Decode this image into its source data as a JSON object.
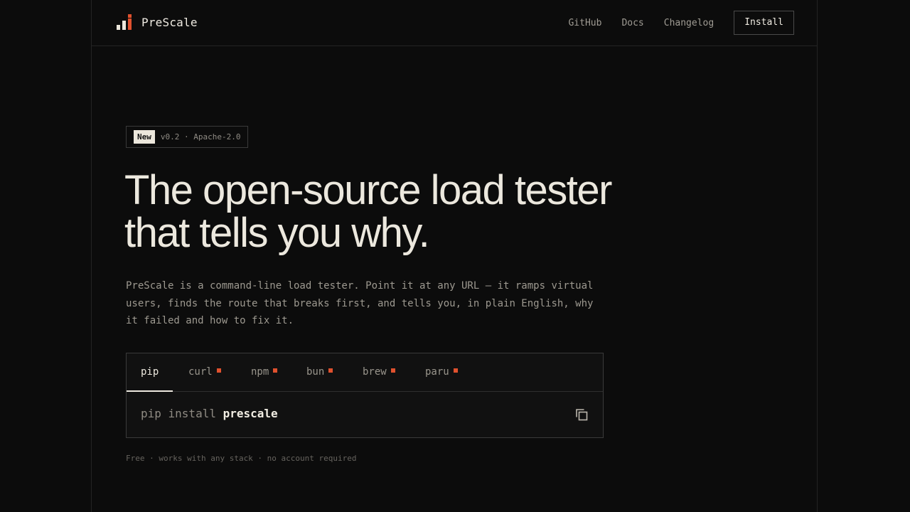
{
  "brand": {
    "name": "PreScale"
  },
  "nav": {
    "links": [
      "GitHub",
      "Docs",
      "Changelog"
    ],
    "install_label": "Install"
  },
  "badge": {
    "new_label": "New",
    "meta": "v0.2 · Apache-2.0"
  },
  "hero": {
    "headline_line1": "The open-source load tester",
    "headline_line2": "that tells you why.",
    "lede": "PreScale is a command-line load tester. Point it at any URL — it ramps virtual users, finds the route that breaks first, and tells you, in plain English, why it failed and how to fix it."
  },
  "installer": {
    "tabs": [
      {
        "label": "pip",
        "active": true,
        "marker": false
      },
      {
        "label": "curl",
        "active": false,
        "marker": true
      },
      {
        "label": "npm",
        "active": false,
        "marker": true
      },
      {
        "label": "bun",
        "active": false,
        "marker": true
      },
      {
        "label": "brew",
        "active": false,
        "marker": true
      },
      {
        "label": "paru",
        "active": false,
        "marker": true
      }
    ],
    "command_prefix": "pip install",
    "command_package": "prescale",
    "copy_icon": "copy-icon"
  },
  "footnote": "Free · works with any stack · no account required",
  "colors": {
    "background": "#0c0c0c",
    "accent": "#e0512e",
    "text": "#ece8de"
  }
}
